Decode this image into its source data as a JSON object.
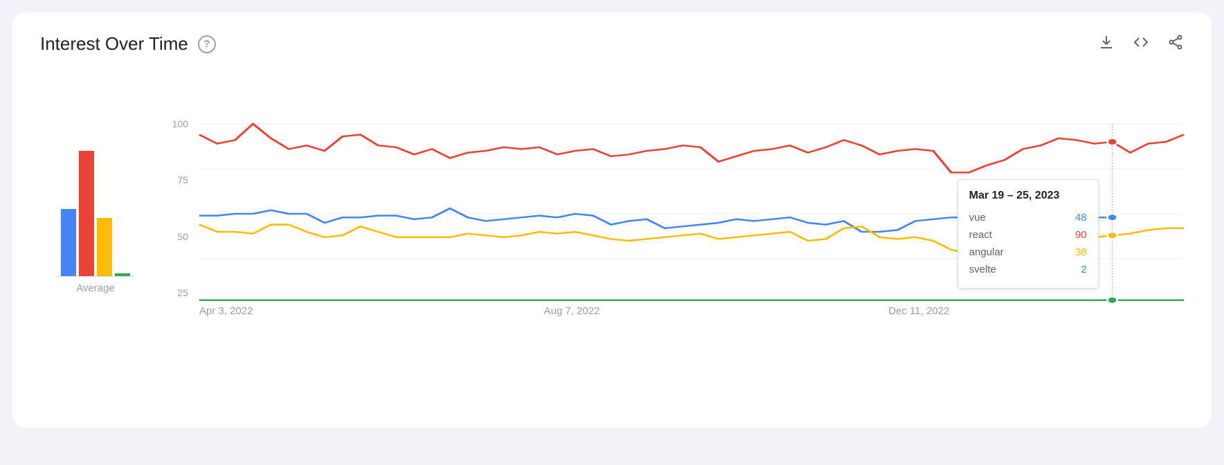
{
  "title": "Interest Over Time",
  "help_glyph": "?",
  "avg_label": "Average",
  "y_ticks": [
    "100",
    "75",
    "50",
    "25"
  ],
  "x_ticks": [
    {
      "label": "Apr 3, 2022",
      "frac": 0.0
    },
    {
      "label": "Aug 7, 2022",
      "frac": 0.35
    },
    {
      "label": "Dec 11, 2022",
      "frac": 0.7
    }
  ],
  "colors": {
    "vue": "#4285f4",
    "react": "#ea4335",
    "angular": "#fbbc04",
    "svelte": "#34a853"
  },
  "averages": {
    "vue": 46,
    "react": 86,
    "angular": 40,
    "svelte": 2
  },
  "tooltip": {
    "title": "Mar 19 – 25, 2023",
    "rows": [
      {
        "key": "vue",
        "label": "vue",
        "value": "48"
      },
      {
        "key": "react",
        "label": "react",
        "value": "90"
      },
      {
        "key": "angular",
        "label": "angular",
        "value": "38"
      },
      {
        "key": "svelte",
        "label": "svelte",
        "value": "2"
      }
    ]
  },
  "chart_data": {
    "type": "line",
    "title": "Interest Over Time",
    "ylabel": "",
    "xlabel": "",
    "ylim": [
      0,
      100
    ],
    "x_index": true,
    "series": [
      {
        "name": "vue",
        "color": "#4285f4",
        "values": [
          49,
          49,
          50,
          50,
          52,
          50,
          50,
          45,
          48,
          48,
          49,
          49,
          47,
          48,
          53,
          48,
          46,
          47,
          48,
          49,
          48,
          50,
          49,
          44,
          46,
          47,
          42,
          43,
          44,
          45,
          47,
          46,
          47,
          48,
          45,
          44,
          46,
          40,
          40,
          41,
          46,
          47,
          48,
          48,
          47,
          47,
          46,
          45,
          48,
          47,
          48,
          48
        ]
      },
      {
        "name": "react",
        "color": "#ea4335",
        "values": [
          94,
          89,
          91,
          100,
          92,
          86,
          88,
          85,
          93,
          94,
          88,
          87,
          83,
          86,
          81,
          84,
          85,
          87,
          86,
          87,
          83,
          85,
          86,
          82,
          83,
          85,
          86,
          88,
          87,
          79,
          82,
          85,
          86,
          88,
          84,
          87,
          91,
          88,
          83,
          85,
          86,
          85,
          73,
          73,
          77,
          80,
          86,
          88,
          92,
          91,
          89,
          90,
          84,
          89,
          90,
          94
        ]
      },
      {
        "name": "angular",
        "color": "#fbbc04",
        "values": [
          44,
          40,
          40,
          39,
          44,
          44,
          40,
          37,
          38,
          43,
          40,
          37,
          37,
          37,
          37,
          39,
          38,
          37,
          38,
          40,
          39,
          40,
          38,
          36,
          35,
          36,
          37,
          38,
          39,
          36,
          37,
          38,
          39,
          40,
          35,
          36,
          42,
          43,
          37,
          36,
          37,
          35,
          30,
          28,
          32,
          36,
          40,
          41,
          39,
          38,
          37,
          38,
          39,
          41,
          42,
          42
        ]
      },
      {
        "name": "svelte",
        "color": "#34a853",
        "values": [
          2,
          2,
          2,
          2,
          2,
          2,
          2,
          2,
          2,
          2,
          2,
          2,
          2,
          2,
          2,
          2,
          2,
          2,
          2,
          2,
          2,
          2,
          2,
          2,
          2,
          2,
          2,
          2,
          2,
          2,
          2,
          2,
          2,
          2,
          2,
          2,
          2,
          2,
          2,
          2,
          2,
          2,
          2,
          2,
          2,
          2,
          2,
          2,
          2,
          2,
          2,
          2,
          2,
          2,
          2,
          2
        ]
      }
    ],
    "highlight_index": 51,
    "highlight_values": {
      "vue": 48,
      "react": 90,
      "angular": 38,
      "svelte": 2
    }
  }
}
